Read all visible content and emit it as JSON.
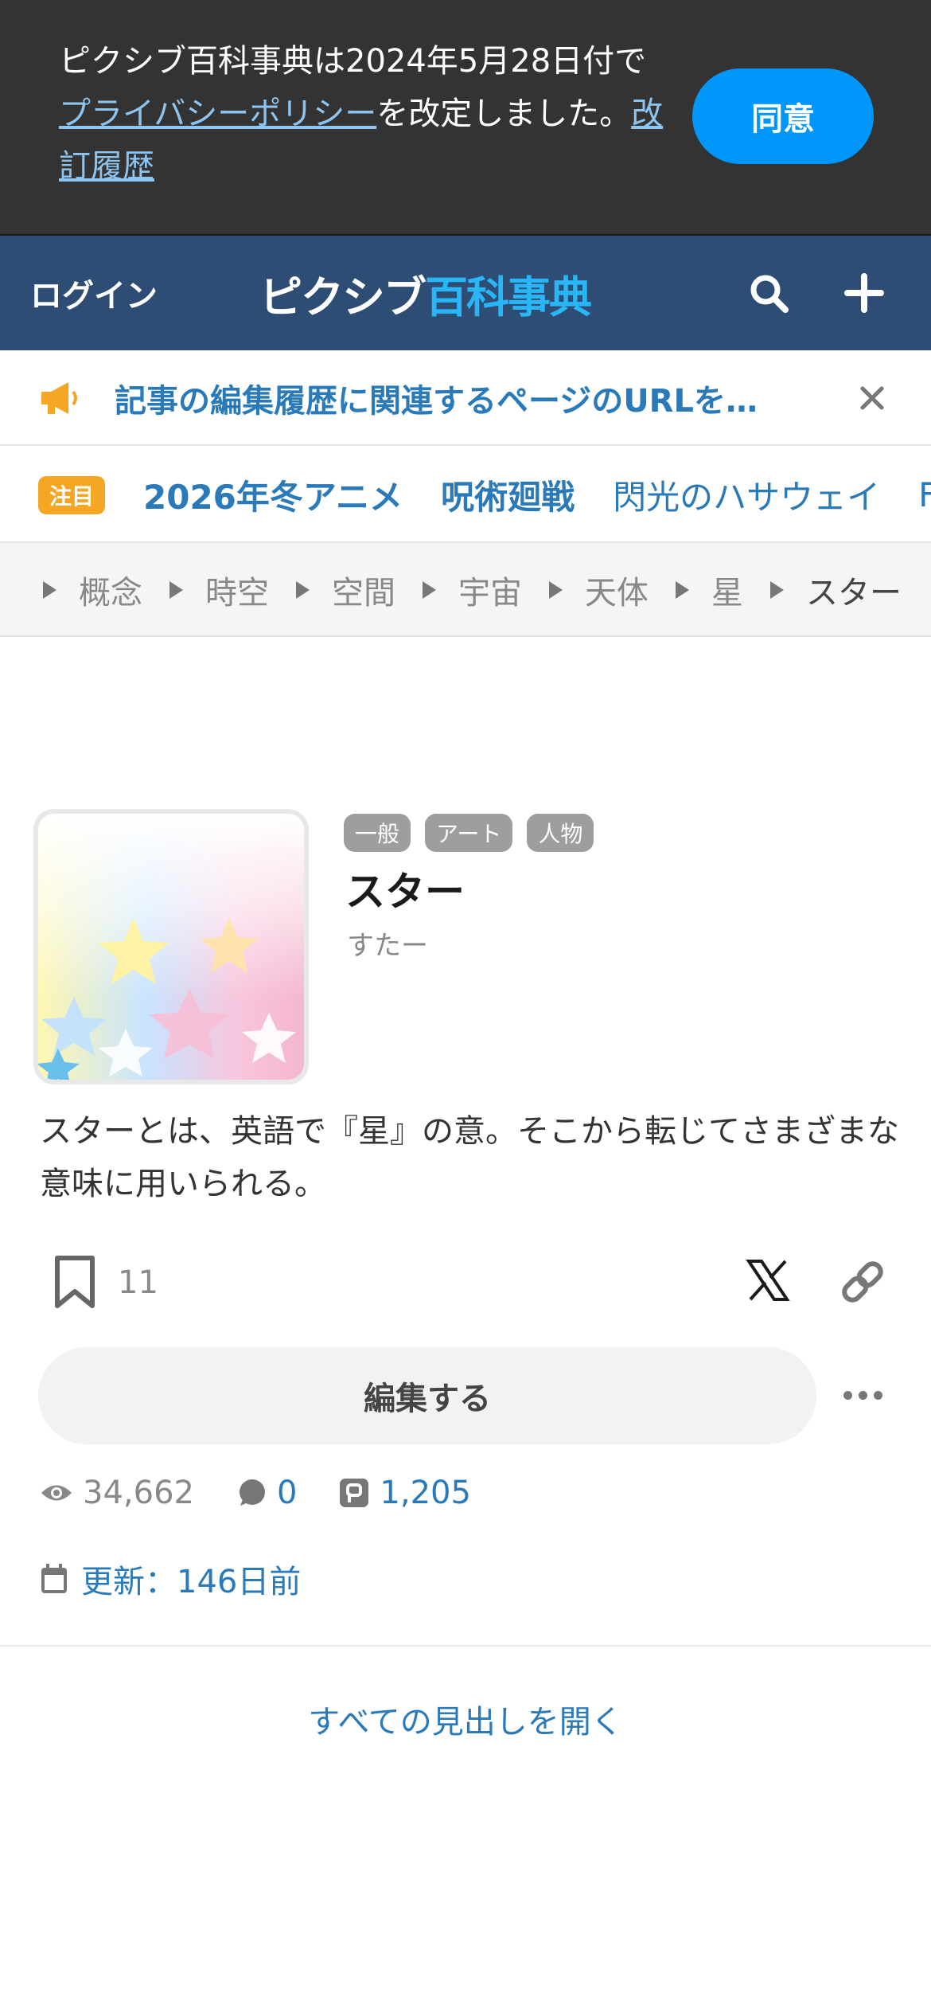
{
  "consent": {
    "text_before": "ピクシブ百科事典は2024年5月28日付で",
    "policy_link": "プライバシーポリシー",
    "text_middle": "を改定しました。",
    "history_link": "改訂履歴",
    "agree_label": "同意"
  },
  "header": {
    "login_label": "ログイン",
    "logo_part1": "ピクシブ",
    "logo_part2": "百科事典",
    "icons": [
      "search-icon",
      "plus-icon"
    ]
  },
  "notice": {
    "icon": "megaphone-icon",
    "text": "記事の編集履歴に関連するページのURLを…",
    "close_icon": "close-icon"
  },
  "trending": {
    "badge": "注目",
    "items": [
      "2026年冬アニメ",
      "呪術廻戦",
      "閃光のハサウェイ",
      "F"
    ]
  },
  "breadcrumbs": [
    "概念",
    "時空",
    "空間",
    "宇宙",
    "天体",
    "星",
    "スター"
  ],
  "article": {
    "tags": [
      "一般",
      "アート",
      "人物"
    ],
    "title": "スター",
    "reading": "すたー",
    "summary": "スターとは、英語で『星』の意。そこから転じてさまざまな意味に用いられる。",
    "bookmark_count": "11",
    "edit_label": "編集する",
    "views": "34,662",
    "comments": "0",
    "pixiv_works": "1,205",
    "updated": "更新：146日前"
  },
  "open_all_headings": "すべての見出しを開く",
  "colors": {
    "consent_bg": "#333333",
    "agree_button": "#0096fa",
    "header_bg": "#2e4d74",
    "link_blue": "#2a79b8",
    "badge_orange": "#f5a623"
  }
}
